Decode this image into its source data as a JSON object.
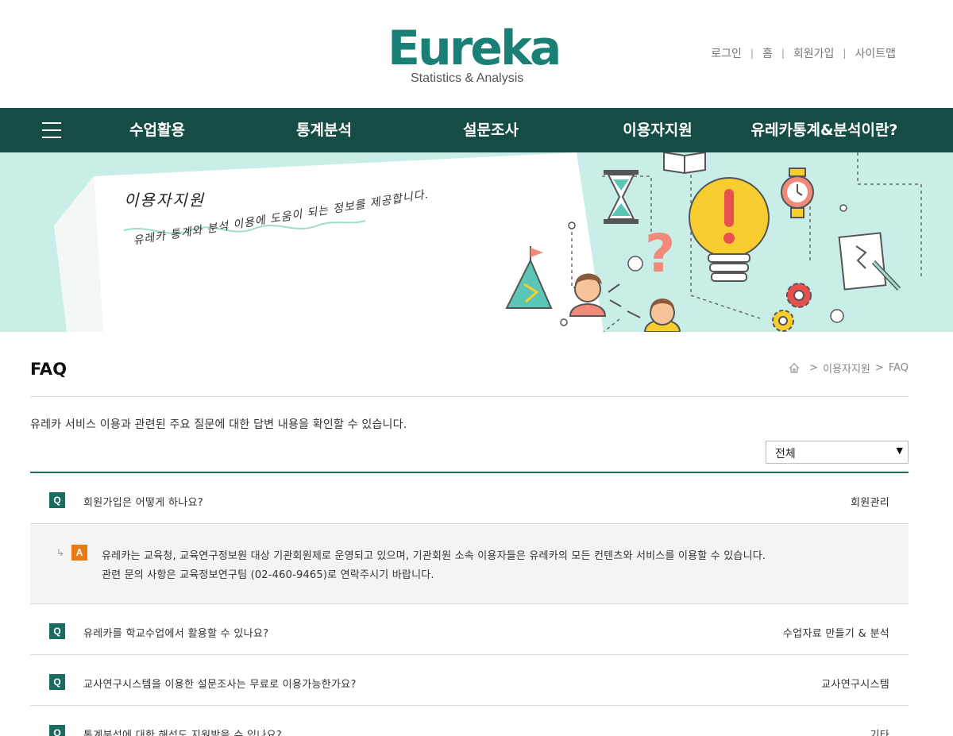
{
  "logo": {
    "main": "Eureka",
    "sub": "Statistics & Analysis"
  },
  "util_links": [
    "로그인",
    "홈",
    "회원가입",
    "사이트맵"
  ],
  "nav": {
    "items": [
      "수업활용",
      "통계분석",
      "설문조사",
      "이용자지원",
      "유레카통계&분석이란?"
    ]
  },
  "banner": {
    "title": "이용자지원",
    "subtitle": "유레카 통계와 분석 이용에 도움이 되는 정보를 제공합니다."
  },
  "page": {
    "title": "FAQ",
    "breadcrumb": [
      "이용자지원",
      "FAQ"
    ],
    "intro": "유레카 서비스 이용과 관련된 주요 질문에 대한 답변 내용을 확인할 수 있습니다.",
    "filter": {
      "selected": "전체"
    }
  },
  "faq": {
    "q_badge": "Q",
    "a_badge": "A",
    "items": [
      {
        "question": "회원가입은 어떻게 하나요?",
        "category": "회원관리",
        "answer_line1": "유레카는 교육청, 교육연구정보원 대상 기관회원제로 운영되고 있으며, 기관회원 소속 이용자들은 유레카의 모든 컨텐츠와 서비스를 이용할 수 있습니다.",
        "answer_line2": "관련 문의 사항은 교육정보연구팀 (02-460-9465)로 연락주시기 바랍니다."
      },
      {
        "question": "유레카를 학교수업에서 활용할 수 있나요?",
        "category": "수업자료 만들기 & 분석"
      },
      {
        "question": "교사연구시스템을 이용한 설문조사는 무료로 이용가능한가요?",
        "category": "교사연구시스템"
      },
      {
        "question": "통계분석에 대한 해석도 지원받을 수 있나요?",
        "category": "기타"
      }
    ]
  },
  "colors": {
    "brand": "#1a7f74",
    "nav_bg": "#154c45",
    "banner_bg": "#c8eee7",
    "q_badge": "#1a6b60",
    "a_badge": "#e97b17"
  }
}
